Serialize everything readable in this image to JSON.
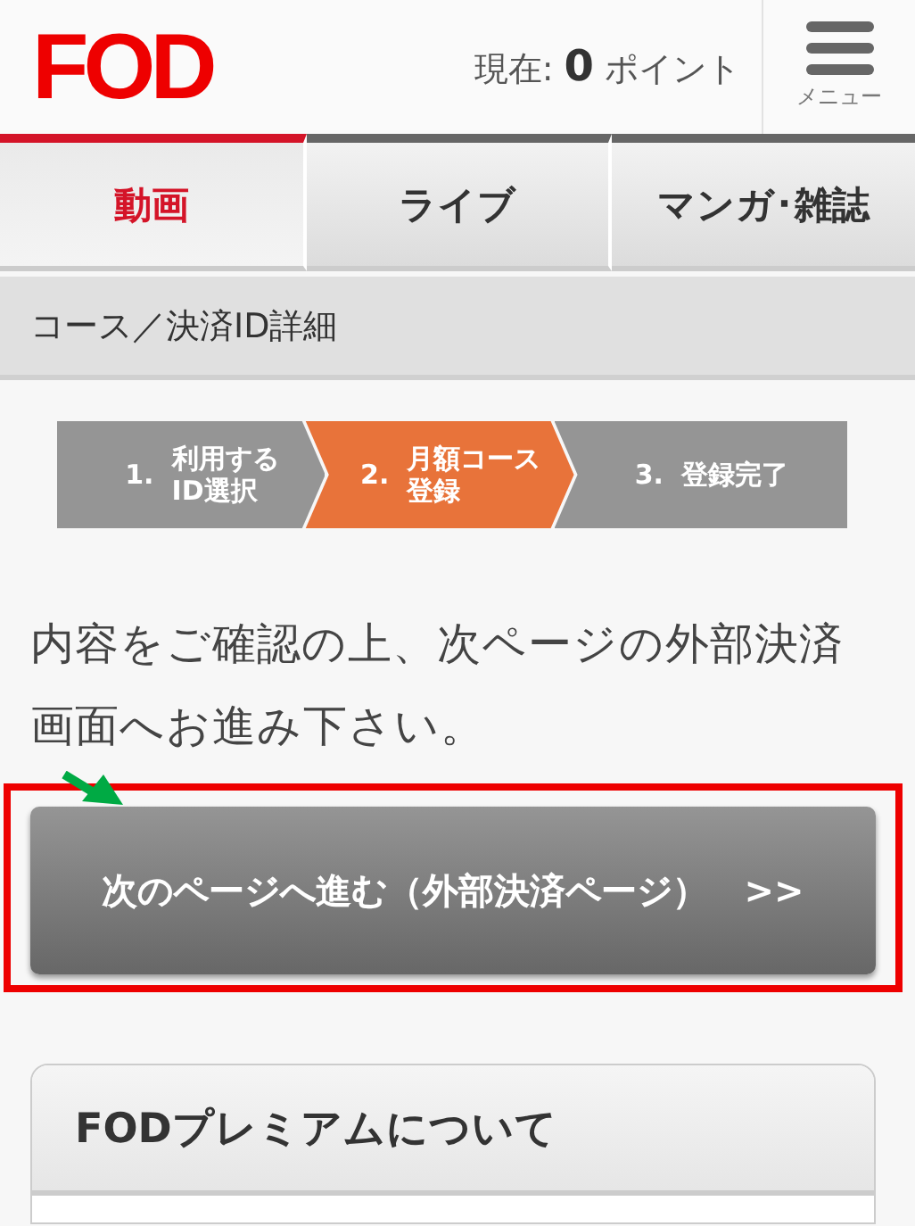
{
  "header": {
    "logo": "FOD",
    "points_label": "現在:",
    "points_value": "0",
    "points_unit": "ポイント",
    "menu_label": "メニュー"
  },
  "tabs": [
    {
      "label": "動画",
      "selected": true
    },
    {
      "label": "ライブ",
      "selected": false
    },
    {
      "label": "マンガ･雑誌",
      "selected": false
    }
  ],
  "section_title": "コース／決済ID詳細",
  "steps": [
    {
      "number": "1.",
      "label_lines": [
        "利用する",
        "ID選択"
      ],
      "selected": false
    },
    {
      "number": "2.",
      "label_lines": [
        "月額コース",
        "登録"
      ],
      "selected": true
    },
    {
      "number": "3.",
      "label_lines": [
        "登録完了"
      ],
      "selected": false
    }
  ],
  "message": "内容をご確認の上、次ページの外部決済画面へお進み下さい。",
  "next_button": "次のページへ進む（外部決済ページ）　>>",
  "card": {
    "title": "FODプレミアムについて"
  },
  "annotations": [
    {
      "kind": "frame"
    },
    {
      "kind": "arrow"
    }
  ]
}
